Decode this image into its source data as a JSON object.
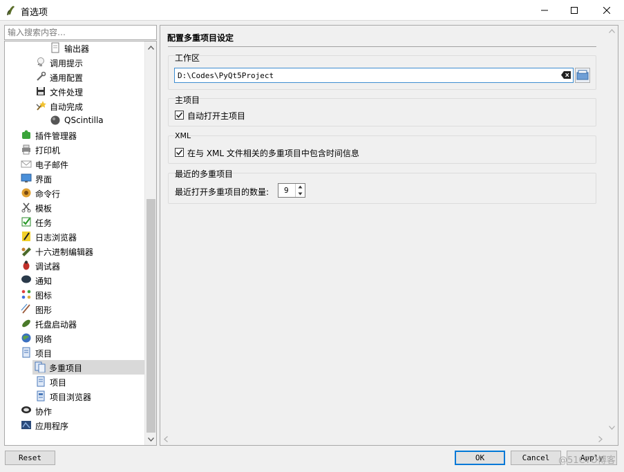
{
  "window": {
    "title": "首选项",
    "icon": "eric-app-icon",
    "controls": [
      "minimize-icon",
      "maximize-icon",
      "close-icon"
    ]
  },
  "sidebar": {
    "search_placeholder": "输入搜索内容…",
    "items": [
      {
        "label": "输出器",
        "icon": "page-icon",
        "level": 2,
        "expander": ""
      },
      {
        "label": "调用提示",
        "icon": "bulb-icon",
        "level": 1,
        "expander": "collapsed"
      },
      {
        "label": "通用配置",
        "icon": "wrench-icon",
        "level": 1,
        "expander": ""
      },
      {
        "label": "文件处理",
        "icon": "floppy-icon",
        "level": 1,
        "expander": ""
      },
      {
        "label": "自动完成",
        "icon": "wand-icon",
        "level": 1,
        "expander": "expanded"
      },
      {
        "label": "QScintilla",
        "icon": "ball-icon",
        "level": 2,
        "expander": ""
      },
      {
        "label": "插件管理器",
        "icon": "puzzle-icon",
        "level": 0,
        "expander": ""
      },
      {
        "label": "打印机",
        "icon": "printer-icon",
        "level": 0,
        "expander": ""
      },
      {
        "label": "电子邮件",
        "icon": "mail-icon",
        "level": 0,
        "expander": ""
      },
      {
        "label": "界面",
        "icon": "monitor-icon",
        "level": 0,
        "expander": "collapsed"
      },
      {
        "label": "命令行",
        "icon": "shell-icon",
        "level": 0,
        "expander": ""
      },
      {
        "label": "模板",
        "icon": "scissors-icon",
        "level": 0,
        "expander": ""
      },
      {
        "label": "任务",
        "icon": "task-check-icon",
        "level": 0,
        "expander": ""
      },
      {
        "label": "日志浏览器",
        "icon": "log-icon",
        "level": 0,
        "expander": ""
      },
      {
        "label": "十六进制编辑器",
        "icon": "hex-editor-icon",
        "level": 0,
        "expander": ""
      },
      {
        "label": "调试器",
        "icon": "bug-icon",
        "level": 0,
        "expander": "collapsed"
      },
      {
        "label": "通知",
        "icon": "bubble-icon",
        "level": 0,
        "expander": ""
      },
      {
        "label": "图标",
        "icon": "icons-icon",
        "level": 0,
        "expander": ""
      },
      {
        "label": "图形",
        "icon": "brush-icon",
        "level": 0,
        "expander": ""
      },
      {
        "label": "托盘启动器",
        "icon": "rocket-icon",
        "level": 0,
        "expander": ""
      },
      {
        "label": "网络",
        "icon": "globe-icon",
        "level": 0,
        "expander": ""
      },
      {
        "label": "项目",
        "icon": "project-icon",
        "level": 0,
        "expander": "expanded"
      },
      {
        "label": "多重项目",
        "icon": "multiproject-icon",
        "level": 1,
        "expander": "",
        "selected": true
      },
      {
        "label": "项目",
        "icon": "project-icon",
        "level": 1,
        "expander": ""
      },
      {
        "label": "项目浏览器",
        "icon": "project-browser-icon",
        "level": 1,
        "expander": ""
      },
      {
        "label": "协作",
        "icon": "cooperation-icon",
        "level": 0,
        "expander": ""
      },
      {
        "label": "应用程序",
        "icon": "application-icon",
        "level": 0,
        "expander": ""
      }
    ]
  },
  "panel": {
    "title": "配置多重项目设定",
    "workspace": {
      "group_title": "工作区",
      "path_value": "D:\\Codes\\PyQt5Project"
    },
    "master_project": {
      "group_title": "主项目",
      "checkbox_label": "自动打开主项目",
      "checked": true
    },
    "xml": {
      "group_title": "XML",
      "checkbox_label": "在与 XML 文件相关的多重项目中包含时间信息",
      "checked": true
    },
    "recent": {
      "group_title": "最近的多重项目",
      "count_label": "最近打开多重项目的数量:",
      "count_value": "9"
    }
  },
  "footer": {
    "reset_label": "Reset",
    "ok_label": "OK",
    "cancel_label": "Cancel",
    "apply_label": "Apply"
  },
  "watermark": "@51CTO博客",
  "colors": {
    "focus_border": "#3c8cd0",
    "selected_row": "#d9d9d9",
    "default_button_border": "#0078d7"
  }
}
